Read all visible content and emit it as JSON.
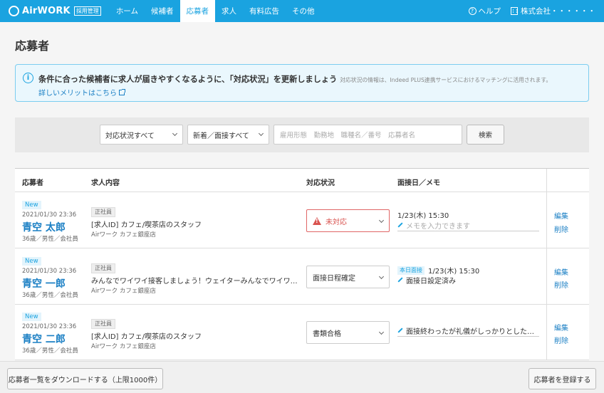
{
  "nav": {
    "logo": "AirWORK",
    "logo_badge": "採用管理",
    "items": [
      "ホーム",
      "候補者",
      "応募者",
      "求人",
      "有料広告",
      "その他"
    ],
    "active": "応募者",
    "help": "ヘルプ",
    "company": "株式会社・・・・・・"
  },
  "page": {
    "title": "応募者"
  },
  "info": {
    "main": "条件に合った候補者に求人が届きやすくなるように、「対応状況」を更新しましょう",
    "sub": "対応状況の情報は、Indeed PLUS連携サービスにおけるマッチングに活用されます。",
    "link": "詳しいメリットはこちら"
  },
  "filter": {
    "status_select": "対応状況すべて",
    "type_select": "新着／面接すべて",
    "search_placeholder": "雇用形態　勤務地　職種名／番号　応募者名",
    "search_button": "検索"
  },
  "table": {
    "headers": [
      "応募者",
      "求人内容",
      "対応状況",
      "面接日／メモ"
    ],
    "rows": [
      {
        "badge": "New",
        "date": "2021/01/30 23:36",
        "name": "青空 太郎",
        "meta": "36歳／男性／会社員",
        "tag": "正社員",
        "job": "[求人ID] カフェ/喫茶店のスタッフ",
        "store": "Airワーク カフェ銀座店",
        "status": "未対応",
        "today": "",
        "interview": "1/23(木) 15:30",
        "memo": "メモを入力できます",
        "edit": "編集",
        "delete": "削除"
      },
      {
        "badge": "New",
        "date": "2021/01/30 23:36",
        "name": "青空 一郎",
        "meta": "36歳／男性／会社員",
        "tag": "正社員",
        "job": "みんなでワイワイ接客しましょう！ウェイターみんなでワイワイ接…",
        "store": "Airワーク カフェ銀座店",
        "status": "面接日程確定",
        "today": "本日面接",
        "interview": "1/23(木) 15:30",
        "memo": "面接日設定済み",
        "edit": "編集",
        "delete": "削除"
      },
      {
        "badge": "New",
        "date": "2021/01/30 23:36",
        "name": "青空 二郎",
        "meta": "36歳／男性／会社員",
        "tag": "正社員",
        "job": "[求人ID] カフェ/喫茶店のスタッフ",
        "store": "Airワーク カフェ銀座店",
        "status": "書類合格",
        "today": "",
        "interview": "",
        "memo": "面接終わったが礼儀がしっかりとしたいい…",
        "edit": "編集",
        "delete": "削除"
      }
    ]
  },
  "footer": {
    "download": "応募者一覧をダウンロードする（上限1000件）",
    "register": "応募者を登録する"
  },
  "colors": {
    "brand": "#1aa3e0",
    "link": "#1a7fc4",
    "alert": "#d9534f"
  }
}
